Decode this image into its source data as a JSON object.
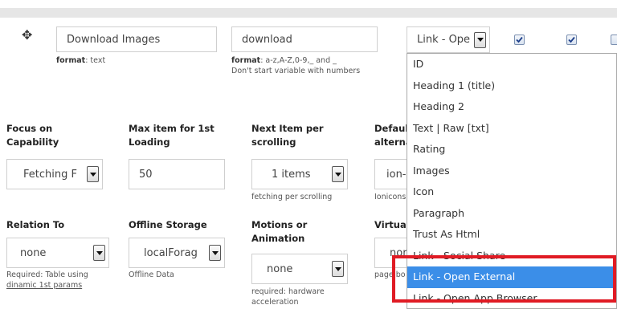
{
  "row1": {
    "name_value": "Download Images",
    "name_hint_key": "format",
    "name_hint_val": ": text",
    "var_value": "download",
    "var_hint_key": "format",
    "var_hint_val": ": a-z,A-Z,0-9,_ and _",
    "var_hint_line2": "Don't start variable with numbers",
    "type_value": "Link - Ope"
  },
  "settings": {
    "focus_label_1": "Focus on",
    "focus_label_2": "Capability",
    "focus_value": "Fetching F",
    "max_label_1": "Max item for 1st",
    "max_label_2": "Loading",
    "max_value": "50",
    "next_label_1": "Next Item per",
    "next_label_2": "scrolling",
    "next_value": "1 items",
    "next_hint": "fetching per scrolling",
    "default_label_1": "Defaul",
    "default_label_2": "alterna",
    "default_value": "ion-",
    "default_hint": "Ionicons",
    "relation_label": "Relation To",
    "relation_value": "none",
    "relation_hint_1": "Required: Table using",
    "relation_hint_2": "dinamic 1st params",
    "offline_label": "Offline Storage",
    "offline_value": "localForag",
    "offline_hint": "Offline Data",
    "motion_label_1": "Motions or",
    "motion_label_2": "Animation",
    "motion_value": "none",
    "motion_hint_1": "required: hardware",
    "motion_hint_2": "acceleration",
    "virtual_label": "Virtual",
    "virtual_value": "nor",
    "virtual_hint": "page bo"
  },
  "dropdown": {
    "options": [
      "ID",
      "Heading 1 (title)",
      "Heading 2",
      "Text | Raw [txt]",
      "Rating",
      "Images",
      "Icon",
      "Paragraph",
      "Trust As Html",
      "Link - Social Share",
      "Link - Open External",
      "Link - Open App Browser"
    ],
    "selected": "Link - Open External"
  },
  "colors": {
    "highlight": "#3b8ee8",
    "annotation": "#e01b24"
  }
}
